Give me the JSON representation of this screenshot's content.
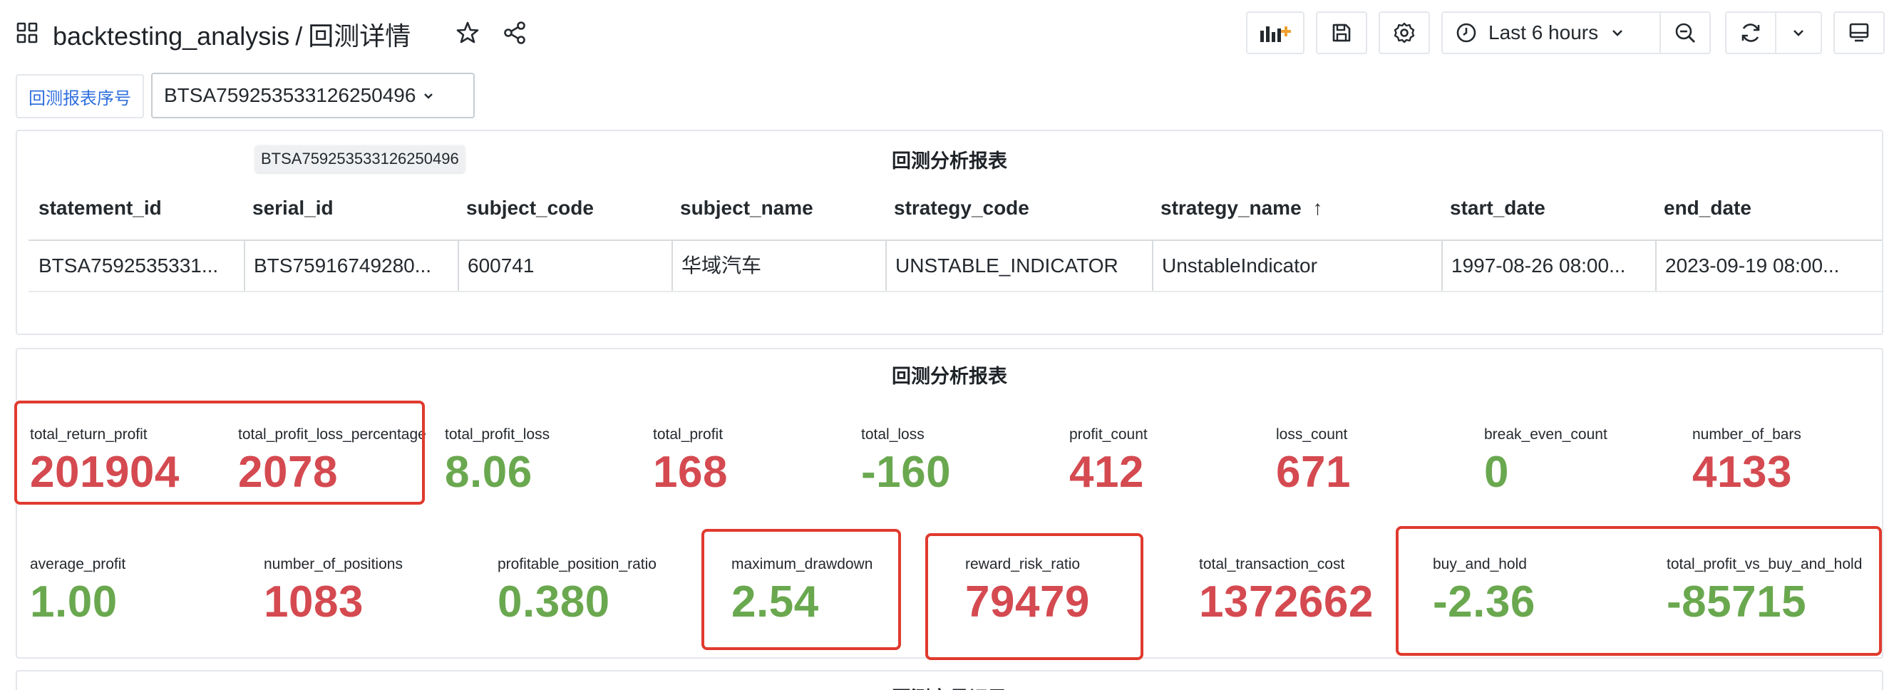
{
  "header": {
    "dashboard_folder": "backtesting_analysis",
    "separator": "/",
    "dashboard_title": "回测详情",
    "time_range": "Last 6 hours"
  },
  "variables": {
    "label": "回测报表序号",
    "selected": "BTSA759253533126250496"
  },
  "panel_table": {
    "title": "回测分析报表",
    "tooltip": "BTSA759253533126250496",
    "columns": [
      "statement_id",
      "serial_id",
      "subject_code",
      "subject_name",
      "strategy_code",
      "strategy_name",
      "start_date",
      "end_date"
    ],
    "sort_indicator": "↑",
    "rows": [
      [
        "BTSA7592535331...",
        "BTS75916749280...",
        "600741",
        "华域汽车",
        "UNSTABLE_INDICATOR",
        "UnstableIndicator",
        "1997-08-26 08:00...",
        "2023-09-19 08:00..."
      ]
    ]
  },
  "panel_stats": {
    "title": "回测分析报表",
    "row1": [
      {
        "label": "total_return_profit",
        "value": "201904",
        "color": "red"
      },
      {
        "label": "total_profit_loss_percentage",
        "value": "2078",
        "color": "red"
      },
      {
        "label": "total_profit_loss",
        "value": "8.06",
        "color": "green"
      },
      {
        "label": "total_profit",
        "value": "168",
        "color": "red"
      },
      {
        "label": "total_loss",
        "value": "-160",
        "color": "green"
      },
      {
        "label": "profit_count",
        "value": "412",
        "color": "red"
      },
      {
        "label": "loss_count",
        "value": "671",
        "color": "red"
      },
      {
        "label": "break_even_count",
        "value": "0",
        "color": "green"
      },
      {
        "label": "number_of_bars",
        "value": "4133",
        "color": "red"
      }
    ],
    "row2": [
      {
        "label": "average_profit",
        "value": "1.00",
        "color": "green"
      },
      {
        "label": "number_of_positions",
        "value": "1083",
        "color": "red"
      },
      {
        "label": "profitable_position_ratio",
        "value": "0.380",
        "color": "green"
      },
      {
        "label": "maximum_drawdown",
        "value": "2.54",
        "color": "green"
      },
      {
        "label": "reward_risk_ratio",
        "value": "79479",
        "color": "red"
      },
      {
        "label": "total_transaction_cost",
        "value": "1372662",
        "color": "red"
      },
      {
        "label": "buy_and_hold",
        "value": "-2.36",
        "color": "green"
      },
      {
        "label": "total_profit_vs_buy_and_hold",
        "value": "-85715",
        "color": "green"
      }
    ]
  },
  "panel_next": {
    "title": "回测交易记录"
  },
  "colors": {
    "red": "#d44a50",
    "green": "#6aa84f",
    "highlight": "#e03a2e",
    "link": "#2f6fde"
  },
  "icons": [
    "apps-icon",
    "star-icon",
    "share-icon",
    "add-panel-icon",
    "save-icon",
    "settings-icon",
    "clock-icon",
    "zoom-out-icon",
    "refresh-icon",
    "chevron-down-icon",
    "tv-mode-icon"
  ]
}
